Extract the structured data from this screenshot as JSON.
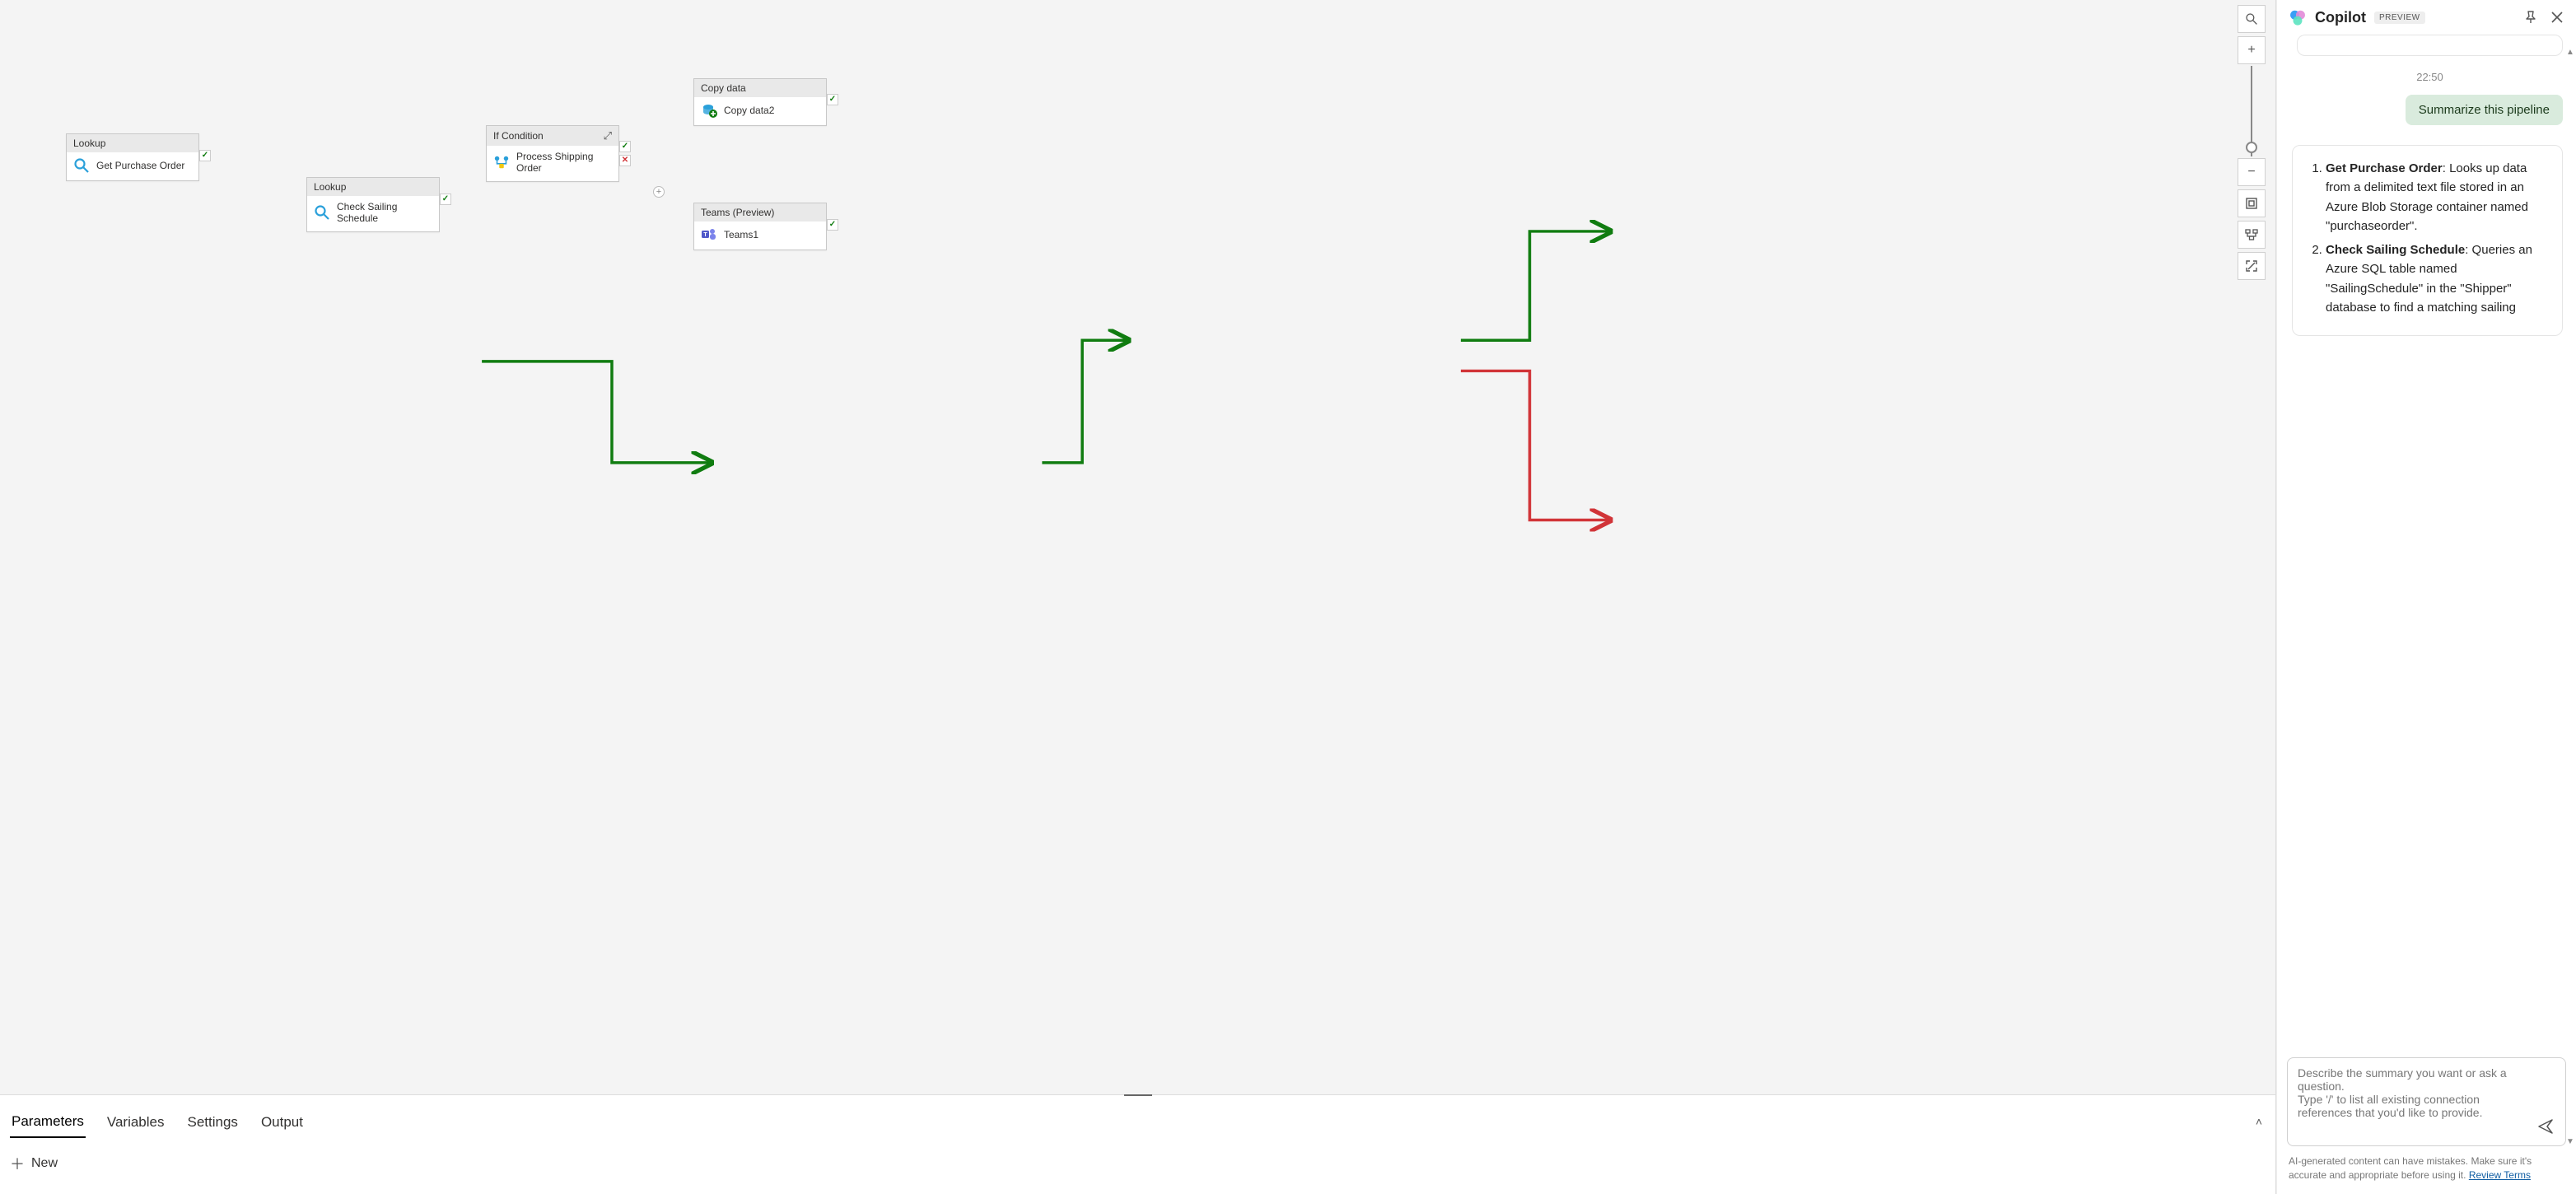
{
  "canvas": {
    "nodes": {
      "lookup1": {
        "type": "Lookup",
        "name": "Get Purchase Order"
      },
      "lookup2": {
        "type": "Lookup",
        "name": "Check Sailing Schedule"
      },
      "ifcond": {
        "type": "If Condition",
        "name": "Process Shipping Order"
      },
      "copy": {
        "type": "Copy data",
        "name": "Copy data2"
      },
      "teams": {
        "type": "Teams (Preview)",
        "name": "Teams1"
      }
    }
  },
  "panel": {
    "tabs": [
      "Parameters",
      "Variables",
      "Settings",
      "Output"
    ],
    "active_tab_index": 0,
    "new_label": "New"
  },
  "copilot": {
    "title": "Copilot",
    "badge": "PREVIEW",
    "timestamp": "22:50",
    "user_msg": "Summarize this pipeline",
    "answer_items": [
      {
        "bold": "Get Purchase Order",
        "rest": ": Looks up data from a delimited text file stored in an Azure Blob Storage container named \"purchaseorder\"."
      },
      {
        "bold": "Check Sailing Schedule",
        "rest": ": Queries an Azure SQL table named \"SailingSchedule\" in the \"Shipper\" database to find a matching sailing"
      }
    ],
    "input_placeholder": "Describe the summary you want or ask a question.\nType '/' to list all existing connection references that you'd like to provide.",
    "disclaimer_pre": "AI-generated content can have mistakes. Make sure it's accurate and appropriate before using it. ",
    "disclaimer_link": "Review Terms"
  }
}
